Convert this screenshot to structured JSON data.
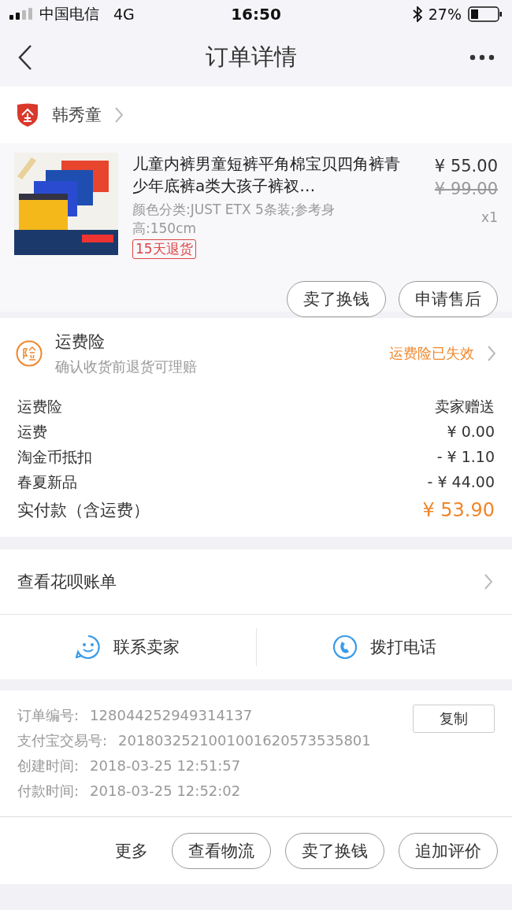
{
  "status_bar": {
    "carrier": "中国电信",
    "network": "4G",
    "time": "16:50",
    "battery": "27%"
  },
  "nav": {
    "title": "订单详情"
  },
  "shop": {
    "name": "韩秀童"
  },
  "product": {
    "title": "儿童内裤男童短裤平角棉宝贝四角裤青少年底裤a类大孩子裤衩…",
    "spec": "颜色分类:JUST ETX 5条装;参考身高:150cm",
    "tag": "15天退货",
    "price": "¥ 55.00",
    "original_price": "¥ 99.00",
    "quantity": "x1",
    "buttons": [
      "卖了换钱",
      "申请售后"
    ]
  },
  "insurance": {
    "title": "运费险",
    "subtitle": "确认收货前退货可理赔",
    "status": "运费险已失效"
  },
  "fees": [
    {
      "kind": "line",
      "label": "运费险",
      "value": "卖家赠送"
    },
    {
      "kind": "line",
      "label": "运费",
      "value": "¥ 0.00"
    },
    {
      "kind": "line",
      "label": "淘金币抵扣",
      "value": "- ¥ 1.10"
    },
    {
      "kind": "line",
      "label": "春夏新品",
      "value": "- ¥ 44.00"
    },
    {
      "kind": "total",
      "label": "实付款（含运费）",
      "value": "¥ 53.90"
    }
  ],
  "huabei": {
    "label": "查看花呗账单"
  },
  "contact": [
    {
      "kind": "chat",
      "label": "联系卖家"
    },
    {
      "kind": "phone",
      "label": "拨打电话"
    }
  ],
  "info": {
    "copy_button": "复制",
    "rows": [
      {
        "label": "订单编号:",
        "value": "128044252949314137"
      },
      {
        "label": "支付宝交易号:",
        "value": "2018032521001001620573535801"
      },
      {
        "label": "创建时间:",
        "value": "2018-03-25 12:51:57"
      },
      {
        "label": "付款时间:",
        "value": "2018-03-25 12:52:02"
      }
    ]
  },
  "bottom_bar": {
    "more": "更多",
    "buttons": [
      "查看物流",
      "卖了换钱",
      "追加评价"
    ]
  }
}
